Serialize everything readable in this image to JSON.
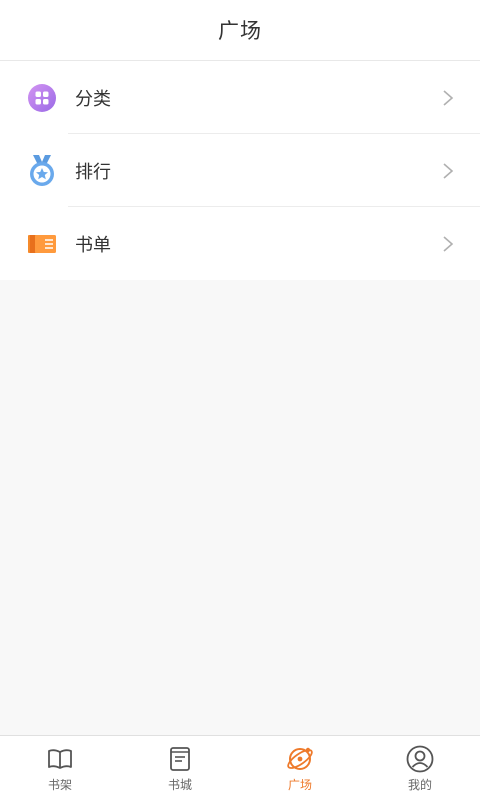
{
  "header": {
    "title": "广场"
  },
  "menu": {
    "items": [
      {
        "label": "分类",
        "icon": "category-icon"
      },
      {
        "label": "排行",
        "icon": "medal-icon"
      },
      {
        "label": "书单",
        "icon": "booklist-icon"
      }
    ]
  },
  "tabbar": {
    "active_index": 2,
    "items": [
      {
        "label": "书架",
        "icon": "bookshelf-icon"
      },
      {
        "label": "书城",
        "icon": "bookstore-icon"
      },
      {
        "label": "广场",
        "icon": "plaza-icon"
      },
      {
        "label": "我的",
        "icon": "profile-icon"
      }
    ]
  },
  "colors": {
    "accent": "#ee7a2b",
    "category_gradient": [
      "#c98af0",
      "#9f6fe8"
    ],
    "medal": "#6aa6e8",
    "booklist": "#f58a2b"
  }
}
